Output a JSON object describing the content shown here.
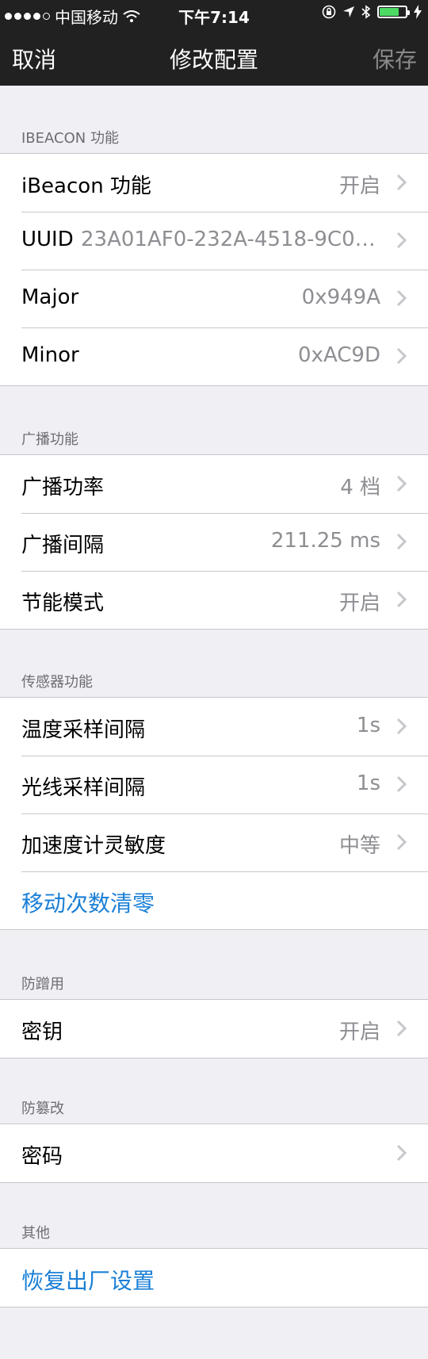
{
  "status_bar": {
    "carrier": "中国移动",
    "time": "下午7:14",
    "battery_percent": 75,
    "battery_color": "#4cd964"
  },
  "nav": {
    "cancel": "取消",
    "title": "修改配置",
    "save": "保存"
  },
  "sections": {
    "ibeacon": {
      "header": "IBEACON 功能",
      "rows": [
        {
          "label": "iBeacon 功能",
          "value": "开启"
        },
        {
          "label": "UUID",
          "value": "23A01AF0-232A-4518-9C0E..."
        },
        {
          "label": "Major",
          "value": "0x949A"
        },
        {
          "label": "Minor",
          "value": "0xAC9D"
        }
      ]
    },
    "broadcast": {
      "header": "广播功能",
      "rows": [
        {
          "label": "广播功率",
          "value": "4 档"
        },
        {
          "label": "广播间隔",
          "value": "211.25 ms"
        },
        {
          "label": "节能模式",
          "value": "开启"
        }
      ]
    },
    "sensor": {
      "header": "传感器功能",
      "rows": [
        {
          "label": "温度采样间隔",
          "value": "1s"
        },
        {
          "label": "光线采样间隔",
          "value": "1s"
        },
        {
          "label": "加速度计灵敏度",
          "value": "中等"
        }
      ],
      "action": "移动次数清零"
    },
    "anti_rub": {
      "header": "防蹭用",
      "rows": [
        {
          "label": "密钥",
          "value": "开启"
        }
      ]
    },
    "anti_tamper": {
      "header": "防篡改",
      "rows": [
        {
          "label": "密码",
          "value": ""
        }
      ]
    },
    "other": {
      "header": "其他",
      "action": "恢复出厂设置"
    }
  },
  "colors": {
    "action_blue": "#1a7fd6",
    "value_gray": "#8e8e93",
    "background": "#efeff4",
    "nav_background": "#212121"
  }
}
